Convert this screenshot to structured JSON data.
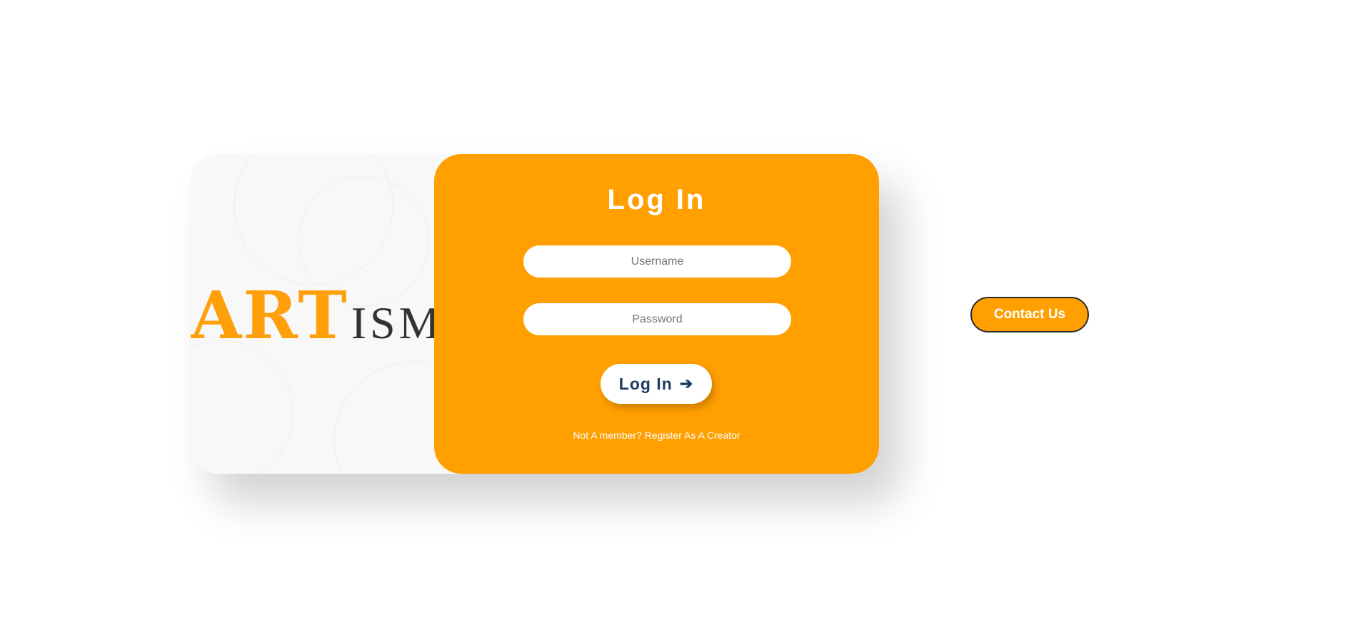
{
  "brand": {
    "logo_art": "ART",
    "logo_ism": "ISM",
    "accent_color": "#ff9f00",
    "dark_text_color": "#333333"
  },
  "login": {
    "title": "Log In",
    "username_placeholder": "Username",
    "password_placeholder": "Password",
    "submit_label": "Log In",
    "submit_icon": "arrow-right-icon",
    "register_text": "Not A member? Register As A Creator"
  },
  "contact": {
    "label": "Contact Us"
  }
}
